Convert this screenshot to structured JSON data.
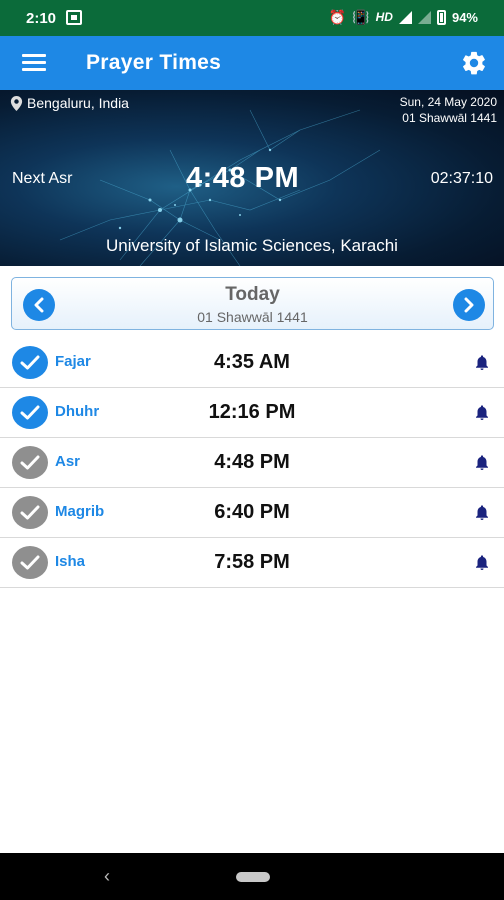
{
  "status_bar": {
    "time": "2:10",
    "hd": "HD",
    "battery": "94%"
  },
  "app_bar": {
    "title": "Prayer Times"
  },
  "header": {
    "location": "Bengaluru, India",
    "gregorian_date": "Sun, 24 May 2020",
    "hijri_date": "01 Shawwāl 1441",
    "next_label": "Next Asr",
    "next_time": "4:48 PM",
    "countdown": "02:37:10",
    "method": "University of Islamic Sciences, Karachi"
  },
  "date_nav": {
    "title": "Today",
    "hijri": "01 Shawwāl 1441"
  },
  "prayers": [
    {
      "name": "Fajar",
      "time": "4:35 AM",
      "checked": true
    },
    {
      "name": "Dhuhr",
      "time": "12:16 PM",
      "checked": true
    },
    {
      "name": "Asr",
      "time": "4:48 PM",
      "checked": false
    },
    {
      "name": "Magrib",
      "time": "6:40 PM",
      "checked": false
    },
    {
      "name": "Isha",
      "time": "7:58 PM",
      "checked": false
    }
  ],
  "colors": {
    "status_bar": "#0b6b3a",
    "primary": "#1e88e5",
    "checked": "#1e88e5",
    "unchecked": "#8f8f8f",
    "bell": "#1a237e"
  },
  "icons": {
    "menu": "menu-icon",
    "settings": "gear-icon",
    "location": "location-pin-icon",
    "previous": "chevron-left-icon",
    "next": "chevron-right-icon",
    "done": "check-icon",
    "notification": "bell-icon"
  }
}
